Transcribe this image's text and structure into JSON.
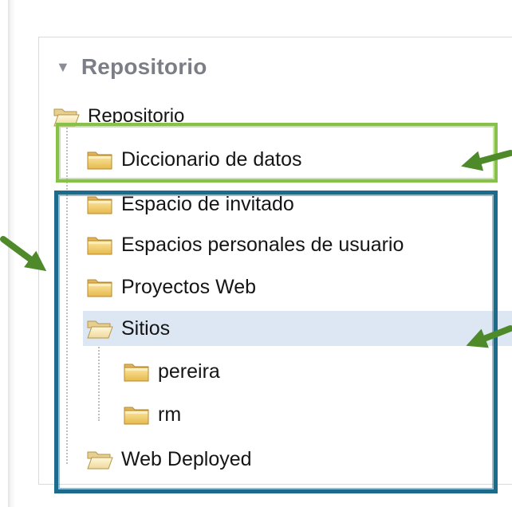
{
  "panel": {
    "title": "Repositorio",
    "collapse_icon": "triangle-down-icon"
  },
  "tree": {
    "root": {
      "label": "Repositorio",
      "icon": "folder-open-icon"
    },
    "items": [
      {
        "label": "Diccionario de datos",
        "icon": "folder-closed-icon",
        "level": 1
      },
      {
        "label": "Espacio de invitado",
        "icon": "folder-closed-icon",
        "level": 1
      },
      {
        "label": "Espacios personales de usuario",
        "icon": "folder-closed-icon",
        "level": 1
      },
      {
        "label": "Proyectos Web",
        "icon": "folder-closed-icon",
        "level": 1
      },
      {
        "label": "Sitios",
        "icon": "folder-open-icon",
        "level": 1,
        "selected": true
      },
      {
        "label": "pereira",
        "icon": "folder-closed-icon",
        "level": 2
      },
      {
        "label": "rm",
        "icon": "folder-closed-icon",
        "level": 2
      },
      {
        "label": "Web Deployed",
        "icon": "folder-open-icon",
        "level": 1
      }
    ]
  },
  "annotations": {
    "green_box_color": "#87c14a",
    "blue_box_color": "#1d6b8c",
    "arrow_color": "#4f8a2a"
  }
}
